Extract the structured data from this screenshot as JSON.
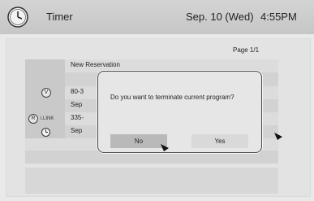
{
  "header": {
    "title": "Timer",
    "date": "Sep. 10 (Wed)",
    "time": "4:55PM"
  },
  "page_indicator": "Page 1/1",
  "list": {
    "rows": [
      {
        "text": "New Reservation"
      },
      {
        "text": "80-3",
        "icon": "V"
      },
      {
        "text": "Sep",
        "icon": ""
      },
      {
        "text": "335-",
        "icon": "R",
        "tag": "i.LINK"
      },
      {
        "text": "Sep",
        "icon": "timer"
      }
    ]
  },
  "dialog": {
    "message": "Do you want to terminate current program?",
    "no_label": "No",
    "yes_label": "Yes",
    "selected": "No"
  }
}
